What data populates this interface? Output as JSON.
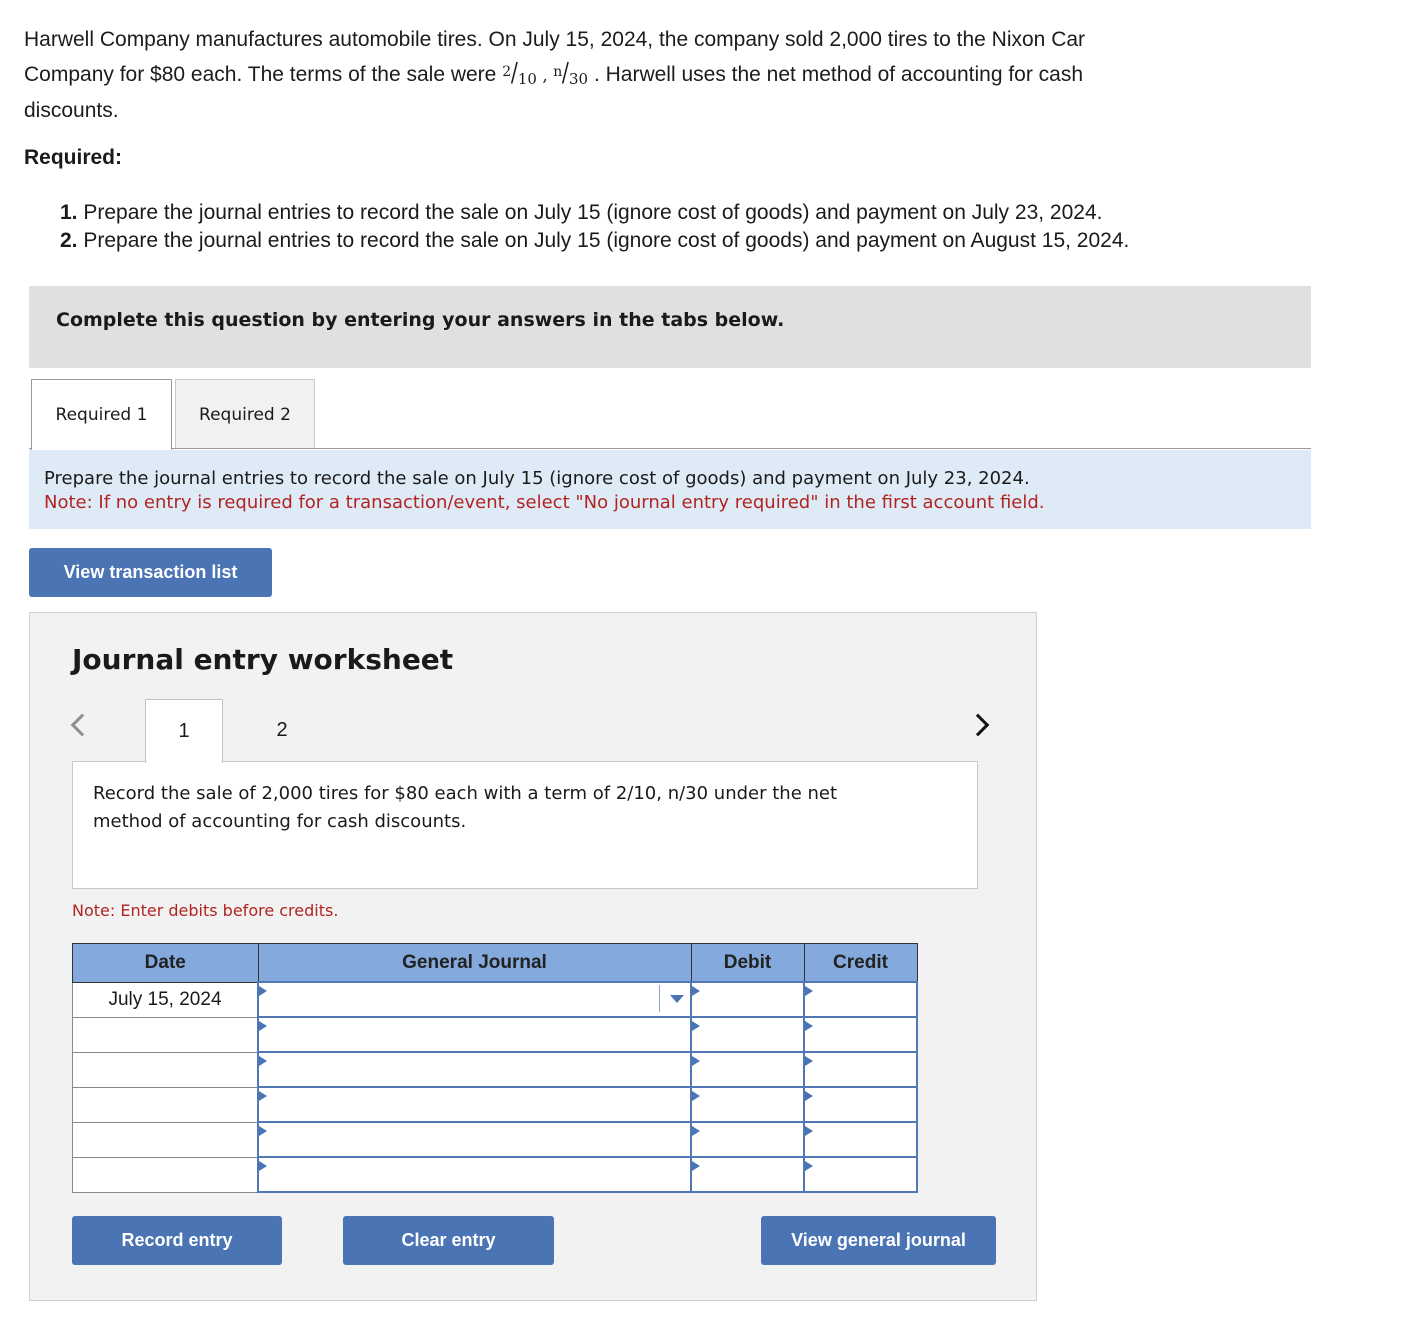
{
  "problem": {
    "line1": "Harwell Company manufactures automobile tires. On July 15, 2024, the company sold 2,000 tires to the Nixon Car",
    "line2_before": "Company for $80 each. The terms of the sale were",
    "terms": {
      "discount_num": "2",
      "discount_den": "10",
      "separator": ",",
      "net_num": "n",
      "net_den": "30"
    },
    "line2_after": ". Harwell uses the net method of accounting for cash",
    "line3": "discounts."
  },
  "required": {
    "heading": "Required:",
    "items": [
      {
        "number": "1.",
        "text": "Prepare the journal entries to record the sale on July 15 (ignore cost of goods) and payment on July 23, 2024."
      },
      {
        "number": "2.",
        "text": "Prepare the journal entries to record the sale on July 15 (ignore cost of goods) and payment on August 15, 2024."
      }
    ]
  },
  "banner": "Complete this question by entering your answers in the tabs below.",
  "tabs": [
    {
      "label": "Required 1",
      "active": true
    },
    {
      "label": "Required 2",
      "active": false
    }
  ],
  "instructions": {
    "text": "Prepare the journal entries to record the sale on July 15 (ignore cost of goods) and payment on July 23, 2024.",
    "note": "Note: If no entry is required for a transaction/event, select \"No journal entry required\" in the first account field."
  },
  "view_transaction_list_label": "View transaction list",
  "worksheet": {
    "title": "Journal entry worksheet",
    "entry_tabs": [
      {
        "label": "1",
        "active": true
      },
      {
        "label": "2",
        "active": false
      }
    ],
    "description": "Record the sale of 2,000 tires for $80 each with a term of 2/10, n/30 under the net method of accounting for cash discounts.",
    "note": "Note: Enter debits before credits.",
    "table": {
      "headers": {
        "date": "Date",
        "account": "General Journal",
        "debit": "Debit",
        "credit": "Credit"
      },
      "rows": [
        {
          "date": "July 15, 2024",
          "account": "",
          "debit": "",
          "credit": ""
        },
        {
          "date": "",
          "account": "",
          "debit": "",
          "credit": ""
        },
        {
          "date": "",
          "account": "",
          "debit": "",
          "credit": ""
        },
        {
          "date": "",
          "account": "",
          "debit": "",
          "credit": ""
        },
        {
          "date": "",
          "account": "",
          "debit": "",
          "credit": ""
        },
        {
          "date": "",
          "account": "",
          "debit": "",
          "credit": ""
        }
      ]
    },
    "buttons": {
      "record": "Record entry",
      "clear": "Clear entry",
      "view_general_journal": "View general journal"
    }
  },
  "colors": {
    "button_blue": "#4a74b4",
    "header_blue": "#83a9dd",
    "note_red": "#b12421",
    "instruction_bg": "#dfeaf7"
  }
}
